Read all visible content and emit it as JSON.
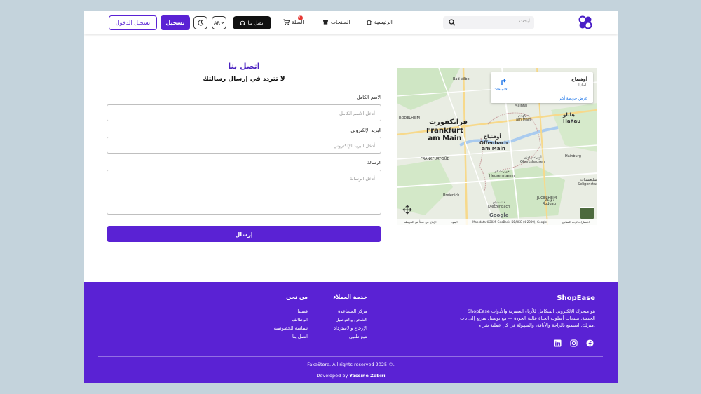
{
  "header": {
    "search_placeholder": "ابحث",
    "nav": {
      "home": "الرئيسية",
      "products": "المنتجات",
      "cart": "السلة",
      "cart_count": "0"
    },
    "contact_button": "اتصل بنا",
    "language": "AR",
    "signup_button": "تسجيل",
    "login_button": "تسجيل الدخول"
  },
  "form": {
    "title": "اتصل بنا",
    "subtitle": "لا تتردد في إرسال رسالتك",
    "name_label": "الاسم الكامل",
    "name_placeholder": "أدخل الاسم الكامل",
    "email_label": "البريد الإلكتروني",
    "email_placeholder": "أدخل البريد الإلكتروني",
    "message_label": "الرسالة",
    "message_placeholder": "أدخل الرسالة",
    "submit": "إرسال"
  },
  "map": {
    "card_title": "أوفنباخ",
    "card_subtitle": "ألمانيا",
    "directions": "الاتجاهات",
    "larger_map": "عرض خريطة أكبر",
    "cities": {
      "bad_vilbel": "Bad Vilbel",
      "maintal": "Maintal",
      "hanau_ar": "هاناو",
      "hanau": "Hanau",
      "muhlheim": "مولهايم\nam Main",
      "frankfurt_ar": "فرانكفورت",
      "frankfurt": "Frankfurt\nam Main",
      "offenbach_ar": "أوفنباخ",
      "offenbach": "Offenbach\nam Main",
      "frankfurt_sud": "FRANKFURT-SÜD",
      "obertshausen": "أوبرتسهاوزن\nObertshausen",
      "heusenstamm": "هويزنشتام\nHeusenstamm",
      "hainburg": "Hainburg",
      "seligenstadt": "سليغنشتات\nSeligenstadt",
      "rodelheim": "RÖDELHEIM",
      "dietzenbach": "ديتسنباخ\nDietzenbach",
      "breienich": "Breienich",
      "rodgau": "رودغاو\nRodgau",
      "jugesheim": "JÜGESHEIM"
    },
    "attribution": {
      "shortcuts": "اختصارات لوحة المفاتيح",
      "data": "Map data ©2025 GeoBasis-DE/BKG (©2009), Google",
      "terms": "البنود",
      "report": "الإبلاغ عن خطأ في الخريطة"
    },
    "google": "Google"
  },
  "footer": {
    "brand": "ShopEase",
    "description": "ShopEase هو متجرك الإلكتروني المتكامل للأزياء العصرية والأدوات الحديثة. منتجات أسلوب الحياة عالية الجودة — مع توصيل سريع إلى باب منزلك. استمتع بالراحة والأناقة، والسهولة في كل عملية شراء.",
    "service_title": "خدمة العملاء",
    "service_links": [
      "مركز المساعدة",
      "الشحن والتوصيل",
      "الإرجاع والاسترداد",
      "تتبع طلبي"
    ],
    "about_title": "من نحن",
    "about_links": [
      "قصتنا",
      "الوظائف",
      "سياسة الخصوصية",
      "اتصل بنا"
    ],
    "copyright": "FakeStore. All rights reserved 2025 ©.",
    "developed_prefix": "Developed by ",
    "developer": "Yassine Zebiri"
  },
  "colors": {
    "brand": "#5a22d4",
    "title": "#4b22c0",
    "page_bg": "#c4d3dc"
  }
}
